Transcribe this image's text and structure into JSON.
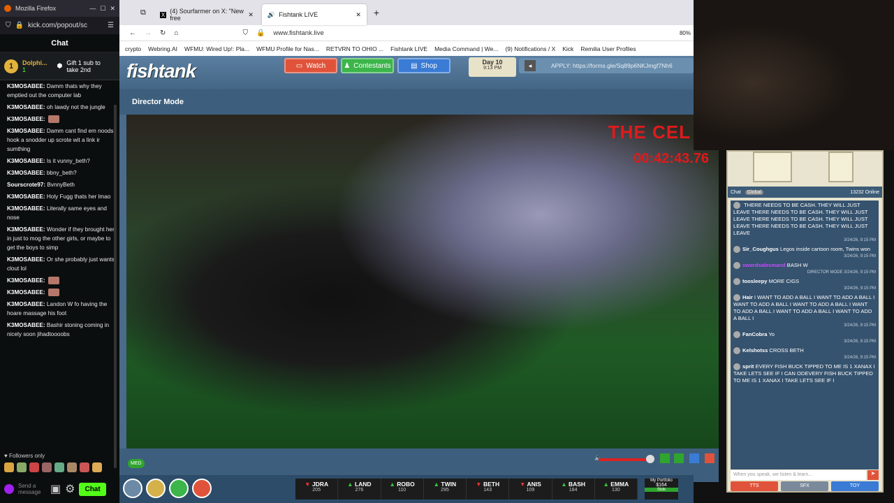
{
  "kick": {
    "window_title": "Mozilla Firefox",
    "url": "kick.com/popout/sc",
    "chat_title": "Chat",
    "pinned_user": "Dolphi...",
    "pinned_count": "1",
    "gift_text": "Gift 1 sub to take 2nd",
    "messages": [
      {
        "user": "K3MOSABEE:",
        "text": "Damm thats why they emptied out the computer lab"
      },
      {
        "user": "K3MOSABEE:",
        "text": "oh lawdy not the jungle"
      },
      {
        "user": "K3MOSABEE:",
        "text": ""
      },
      {
        "user": "K3MOSABEE:",
        "text": "Damm cant find em noods, hook a snodder up scrote wit a link ir sumthing"
      },
      {
        "user": "K3MOSABEE:",
        "text": "Is it vunny_beth?"
      },
      {
        "user": "K3MOSABEE:",
        "text": "bbny_beth?"
      },
      {
        "user": "Sourscrote97:",
        "text": "BvnnyBeth"
      },
      {
        "user": "K3MOSABEE:",
        "text": "Holy Fugg thats her lmao"
      },
      {
        "user": "K3MOSABEE:",
        "text": "Literally same eyes and nose"
      },
      {
        "user": "K3MOSABEE:",
        "text": "Wonder if they brought her in just to mog the other girls, or maybe to get the boys to simp"
      },
      {
        "user": "K3MOSABEE:",
        "text": "Or she probably just wants clout lol"
      },
      {
        "user": "K3MOSABEE:",
        "text": ""
      },
      {
        "user": "K3MOSABEE:",
        "text": ""
      },
      {
        "user": "K3MOSABEE:",
        "text": "Landon W fo having the hoare massage his foot"
      },
      {
        "user": "K3MOSABEE:",
        "text": "Bashir stoning coming in nicely soon jihadtoooobs"
      }
    ],
    "followers_only": "Followers only",
    "input_placeholder": "Send a message",
    "chat_button": "Chat"
  },
  "browser": {
    "tabs": [
      {
        "label": "(4) Sourfarmer on X: \"New free"
      },
      {
        "label": "Fishtank LIVE"
      }
    ],
    "url": "www.fishtank.live",
    "zoom": "80%",
    "bookmarks": [
      "crypto",
      "Webring.AI",
      "WFMU: Wired Up!: Pla...",
      "WFMU Profile for Nas...",
      "RETVRN TO OHIO ...",
      "Fishtank LIVE",
      "Media Command | We...",
      "(9) Notifications / X",
      "Kick",
      "Remilia User Profiles"
    ]
  },
  "fishtank": {
    "logo": "fishtank",
    "nav": {
      "watch": "Watch",
      "contestants": "Contestants",
      "shop": "Shop"
    },
    "day": "Day 10",
    "time": "9:13 PM",
    "apply": "APPLY: https://forms.gle/Sq89p6NKJmgf7Nh6",
    "director_mode": "Director Mode",
    "cam_title": "THE CEL",
    "cam_timer": "00:42:43.76",
    "quality": "MED",
    "scores": [
      {
        "name": "JDRA",
        "pts": "205",
        "dir": "down"
      },
      {
        "name": "LAND",
        "pts": "276",
        "dir": "up"
      },
      {
        "name": "ROBO",
        "pts": "110",
        "dir": "up"
      },
      {
        "name": "TWIN",
        "pts": "295",
        "dir": "up"
      },
      {
        "name": "BETH",
        "pts": "143",
        "dir": "down"
      },
      {
        "name": "ANIS",
        "pts": "109",
        "dir": "down"
      },
      {
        "name": "BASH",
        "pts": "184",
        "dir": "up"
      },
      {
        "name": "EMMA",
        "pts": "130",
        "dir": "up"
      }
    ],
    "portfolio": "My Portfolio",
    "portfolio_val": "$164",
    "stock": "Stok"
  },
  "rchat": {
    "tab": "Chat",
    "global": "Global",
    "online": "13232 Online",
    "messages": [
      {
        "user": "",
        "text": "THERE NEEDS TO BE CASH. THEY WILL JUST LEAVE THERE NEEDS TO BE CASH. THEY WILL JUST LEAVE THERE NEEDS TO BE CASH. THEY WILL JUST LEAVE THERE NEEDS TO BE CASH. THEY WILL JUST LEAVE",
        "ts": "3/24/26, 9:15 PM"
      },
      {
        "user": "Sir_Coughgus",
        "text": "Legos inside cartoon room, Twins won",
        "ts": "3/24/26, 9:15 PM"
      },
      {
        "user": "swordsalesmand",
        "text": "BASH W",
        "ts": "DIRECTOR MODE 3/24/26, 9:15 PM"
      },
      {
        "user": "toosleepy",
        "text": "MORE CIGS",
        "ts": "3/24/26, 9:15 PM"
      },
      {
        "user": "Hair",
        "text": "I WANT TO ADD A BALL I WANT TO ADD A BALL I WANT TO ADD A BALL I WANT TO ADD A BALL I WANT TO ADD A BALL I WANT TO ADD A BALL I WANT TO ADD A BALL I",
        "ts": "3/24/26, 9:15 PM"
      },
      {
        "user": "FanCobra",
        "text": "Yo",
        "ts": "3/24/26, 9:15 PM"
      },
      {
        "user": "Kelshotss",
        "text": "CROSS BETH",
        "ts": "3/24/26, 9:15 PM"
      },
      {
        "user": "sprit",
        "text": "EVERY FISH BUCK TIPPED TO ME IS 1 XANAX I TAKE LETS SEE IF I CAN ODEVERY FISH BUCK TIPPED TO ME IS 1 XANAX I TAKE LETS SEE IF I",
        "ts": ""
      }
    ],
    "input_placeholder": "When you speak, we listen & learn...",
    "tts": "TTS",
    "sfx": "SFX",
    "toy": "TOY"
  }
}
